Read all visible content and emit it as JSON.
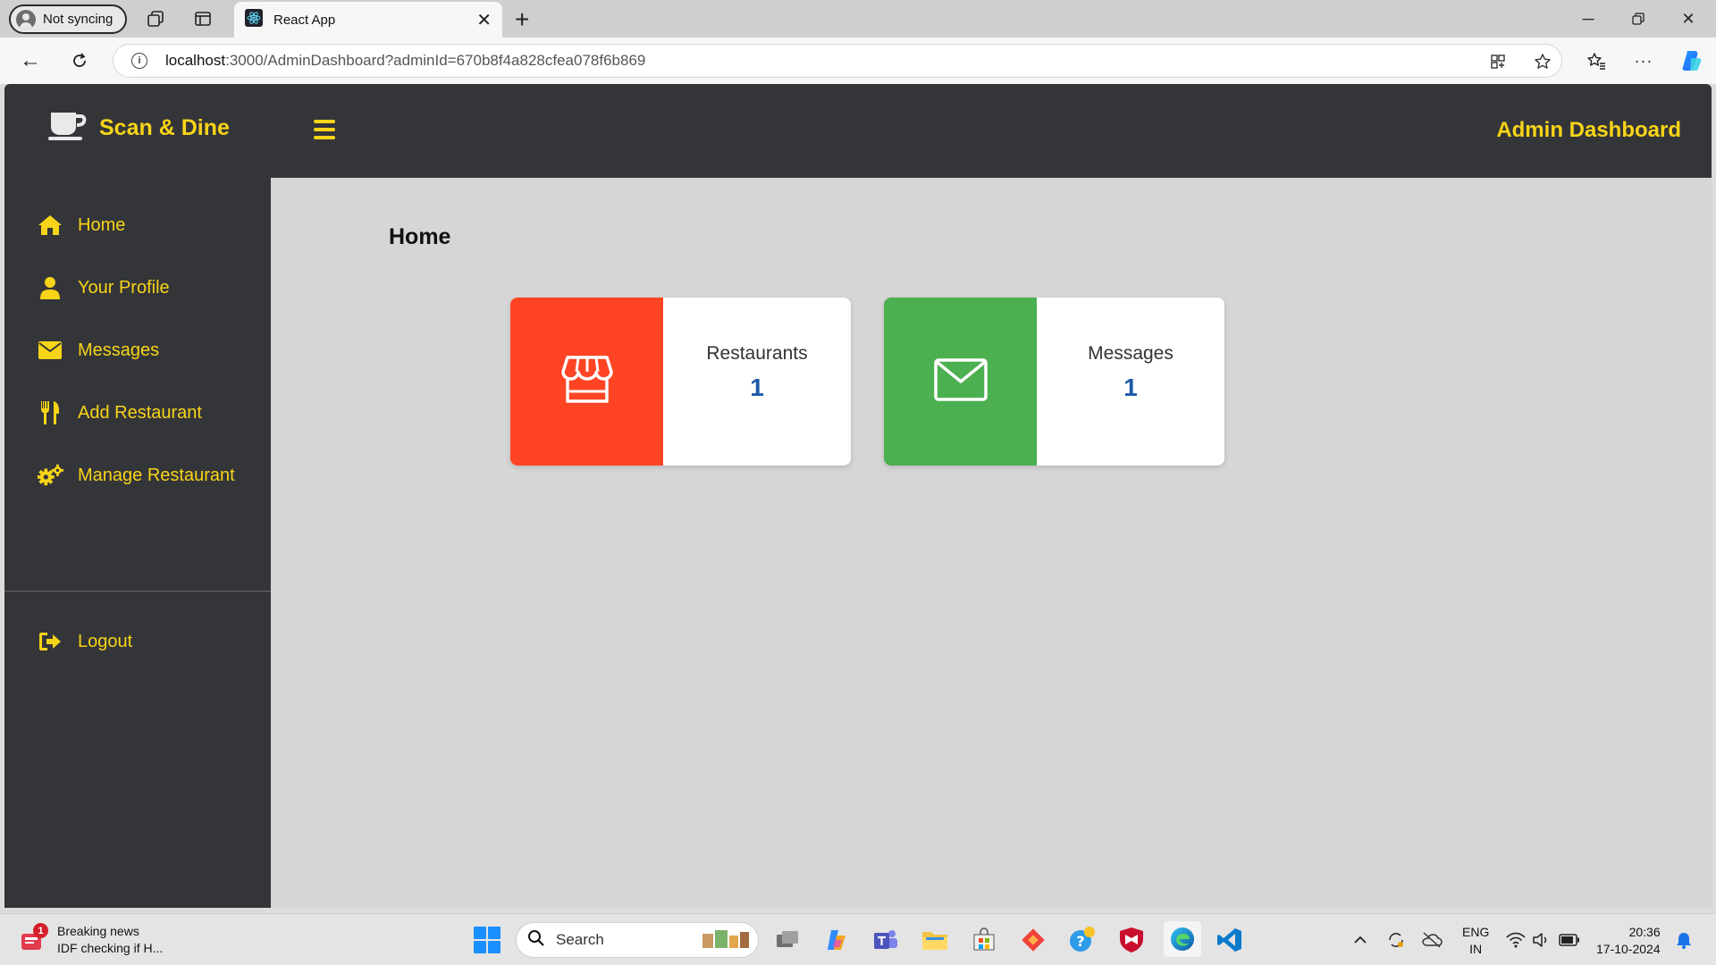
{
  "browser": {
    "profile_label": "Not syncing",
    "tab_title": "React App",
    "url_host": "localhost",
    "url_rest": ":3000/AdminDashboard?adminId=670b8f4a828cfea078f6b869"
  },
  "app": {
    "brand": "Scan & Dine",
    "header_title": "Admin Dashboard",
    "accent_color": "#f7d417",
    "sidebar": {
      "items": [
        {
          "label": "Home",
          "icon": "home-icon"
        },
        {
          "label": "Your Profile",
          "icon": "user-icon"
        },
        {
          "label": "Messages",
          "icon": "envelope-icon"
        },
        {
          "label": "Add Restaurant",
          "icon": "utensils-icon"
        },
        {
          "label": "Manage Restaurant",
          "icon": "cogs-icon"
        }
      ],
      "logout": {
        "label": "Logout",
        "icon": "sign-out-icon"
      }
    },
    "main": {
      "title": "Home",
      "cards": [
        {
          "label": "Restaurants",
          "value": "1",
          "color": "#ff4424",
          "icon": "store-icon"
        },
        {
          "label": "Messages",
          "value": "1",
          "color": "#4caf50",
          "icon": "envelope-icon"
        }
      ]
    }
  },
  "taskbar": {
    "news_badge": "1",
    "news_title": "Breaking news",
    "news_subtitle": "IDF checking if H...",
    "search_label": "Search",
    "lang_line1": "ENG",
    "lang_line2": "IN",
    "time": "20:36",
    "date": "17-10-2024"
  }
}
